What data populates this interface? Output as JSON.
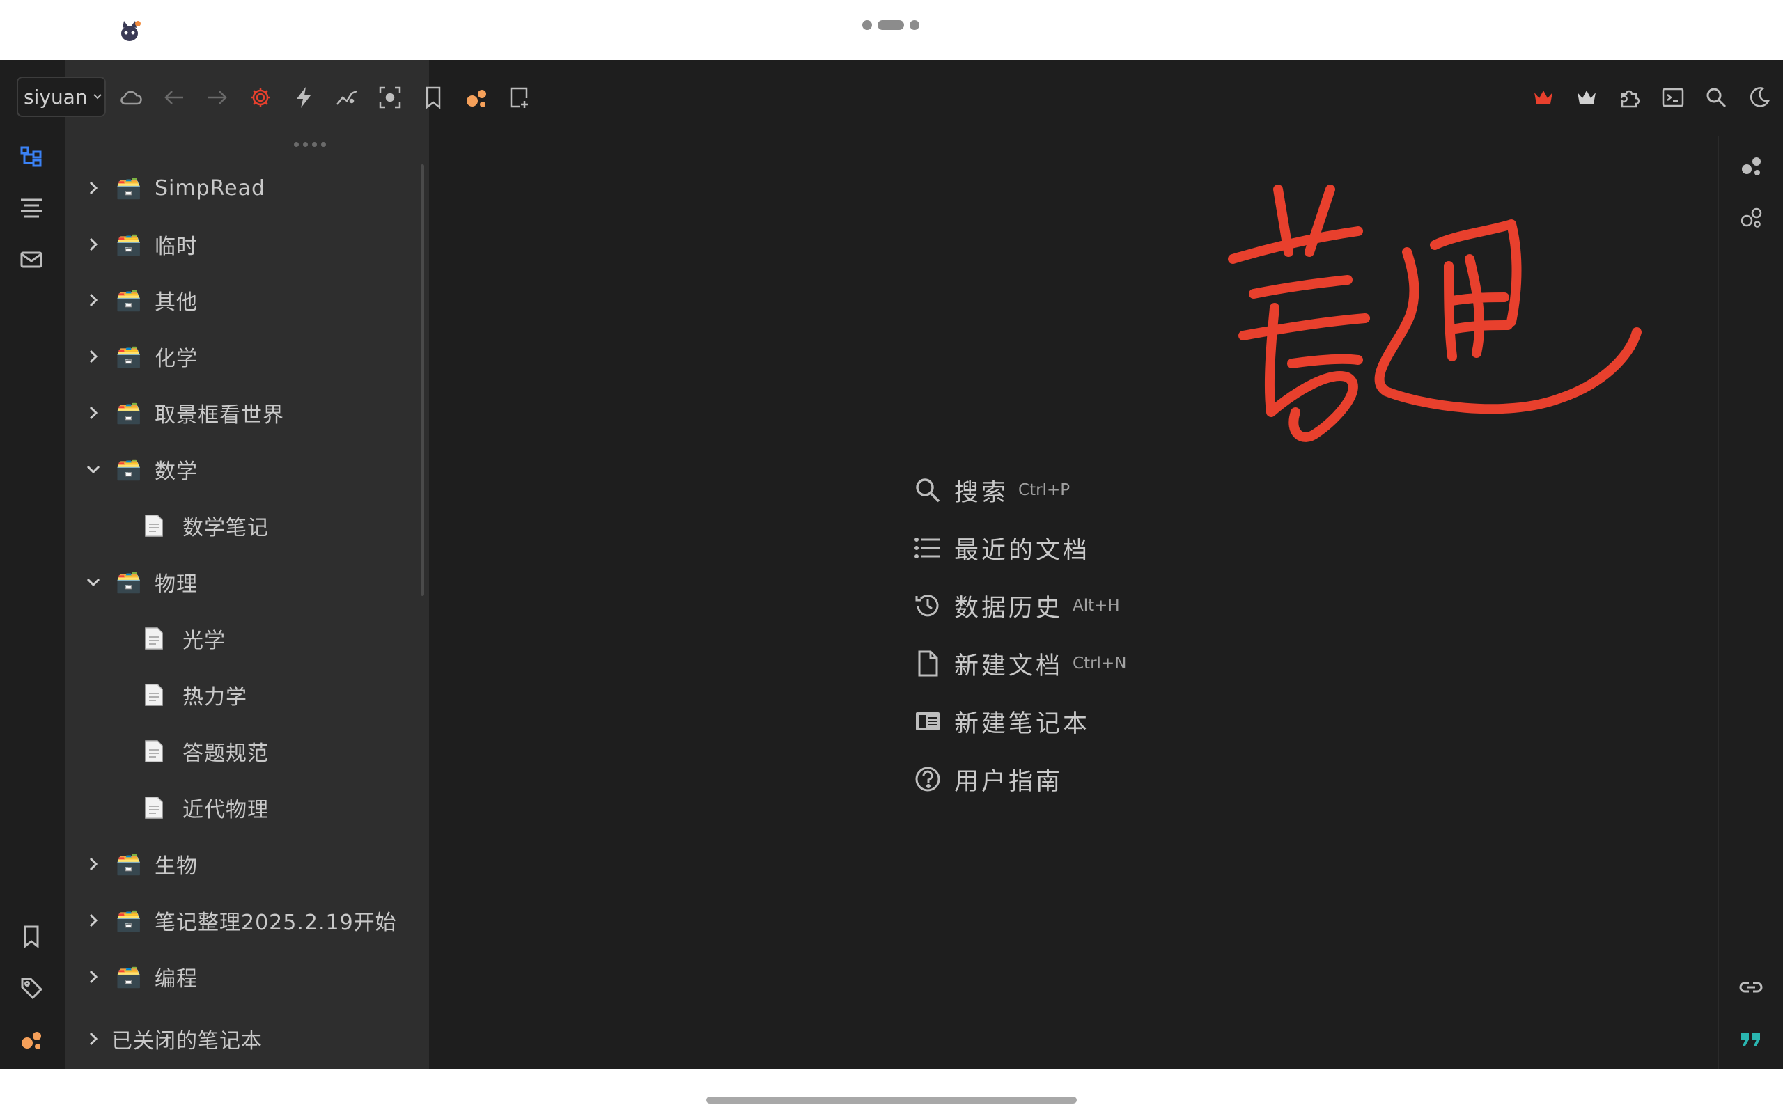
{
  "toolbar": {
    "workspace": "siyuan",
    "icons": [
      "cloud-sync-icon",
      "back-icon",
      "forward-icon",
      "settings-icon",
      "lightning-icon",
      "graph-icon",
      "focus-icon",
      "bookmark-icon",
      "plugin-bubble-icon",
      "quick-note-icon"
    ],
    "right_icons": [
      "crown-red-icon",
      "crown-icon",
      "plugin-icon",
      "terminal-icon",
      "search-icon",
      "dark-mode-icon"
    ]
  },
  "tree": {
    "items": [
      {
        "label": "SimpRead",
        "type": "notebook",
        "expanded": false
      },
      {
        "label": "临时",
        "type": "notebook",
        "expanded": false
      },
      {
        "label": "其他",
        "type": "notebook",
        "expanded": false
      },
      {
        "label": "化学",
        "type": "notebook",
        "expanded": false
      },
      {
        "label": "取景框看世界",
        "type": "notebook",
        "expanded": false
      },
      {
        "label": "数学",
        "type": "notebook",
        "expanded": true
      },
      {
        "label": "数学笔记",
        "type": "doc"
      },
      {
        "label": "物理",
        "type": "notebook",
        "expanded": true
      },
      {
        "label": "光学",
        "type": "doc"
      },
      {
        "label": "热力学",
        "type": "doc"
      },
      {
        "label": "答题规范",
        "type": "doc"
      },
      {
        "label": "近代物理",
        "type": "doc"
      },
      {
        "label": "生物",
        "type": "notebook",
        "expanded": false
      },
      {
        "label": "笔记整理2025.2.19开始",
        "type": "notebook",
        "expanded": false
      },
      {
        "label": "编程",
        "type": "notebook",
        "expanded": false
      }
    ],
    "closed_label": "已关闭的笔记本"
  },
  "main": {
    "signature_text": "蓋通",
    "menu": [
      {
        "icon": "search-icon",
        "label": "搜索",
        "shortcut": "Ctrl+P"
      },
      {
        "icon": "list-icon",
        "label": "最近的文档",
        "shortcut": ""
      },
      {
        "icon": "history-icon",
        "label": "数据历史",
        "shortcut": "Alt+H"
      },
      {
        "icon": "file-icon",
        "label": "新建文档",
        "shortcut": "Ctrl+N"
      },
      {
        "icon": "notebook-icon",
        "label": "新建笔记本",
        "shortcut": ""
      },
      {
        "icon": "help-icon",
        "label": "用户指南",
        "shortcut": ""
      }
    ]
  },
  "colors": {
    "background": "#1e1e1e",
    "panel": "#2e2e2e",
    "text": "#c9c9c9",
    "accent_blue": "#3b82f6",
    "accent_red": "#e8402d",
    "accent_orange": "#f5a05a",
    "accent_teal": "#2ab5b0"
  }
}
